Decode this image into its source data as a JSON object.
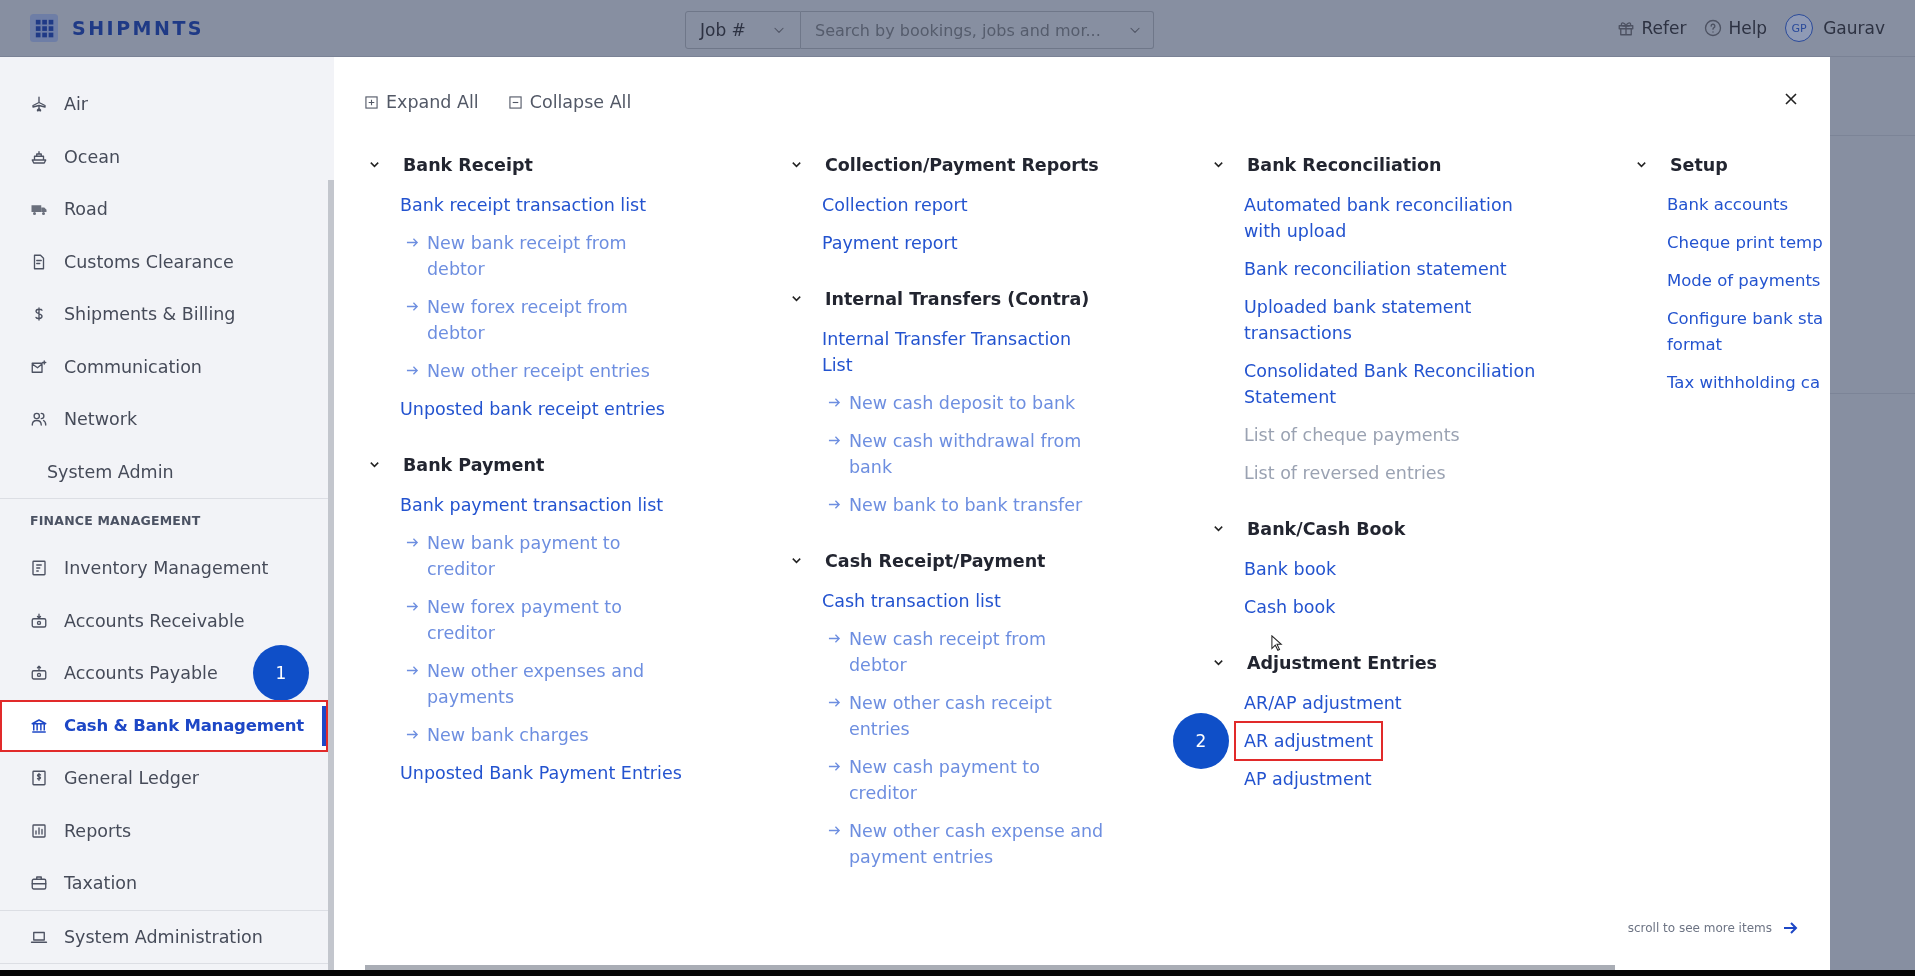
{
  "top_bar": {
    "logo": "SHIPMNTS",
    "search_type": "Job #",
    "search": {
      "placeholder": "Search by bookings, jobs and mor..."
    },
    "refer": "Refer",
    "help": "Help",
    "avatar": "GP",
    "user": "Gaurav"
  },
  "sidebar": {
    "groups": [
      {
        "items": [
          {
            "label": "Air",
            "selected": false,
            "highlighted": false
          },
          {
            "label": "Ocean",
            "selected": false,
            "highlighted": false
          },
          {
            "label": "Road",
            "selected": false,
            "highlighted": false
          },
          {
            "label": "Customs Clearance",
            "selected": false,
            "highlighted": false
          },
          {
            "label": "Shipments & Billing",
            "selected": false,
            "highlighted": false
          },
          {
            "label": "Communication",
            "selected": false,
            "highlighted": false
          },
          {
            "label": "Network",
            "selected": false,
            "highlighted": false
          },
          {
            "label": "System Admin",
            "selected": false,
            "highlighted": false,
            "kind": "plain"
          }
        ]
      },
      {
        "heading": "FINANCE MANAGEMENT",
        "items": [
          {
            "label": "Inventory Management",
            "selected": false,
            "highlighted": false
          },
          {
            "label": "Accounts Receivable",
            "selected": false,
            "highlighted": false
          },
          {
            "label": "Accounts Payable",
            "selected": false,
            "highlighted": false,
            "marker": "1"
          },
          {
            "label": "Cash & Bank Management",
            "selected": true,
            "highlighted": true
          },
          {
            "label": "General Ledger",
            "selected": false,
            "highlighted": false
          },
          {
            "label": "Reports",
            "selected": false,
            "highlighted": false
          },
          {
            "label": "Taxation",
            "selected": false,
            "highlighted": false
          }
        ]
      },
      {
        "items": [
          {
            "label": "System Administration",
            "selected": false,
            "highlighted": false
          }
        ]
      }
    ]
  },
  "panel": {
    "expand_all": "Expand All",
    "collapse_all": "Collapse All",
    "footer": "scroll to see more items",
    "columns": [
      {
        "sections": [
          {
            "title": "Bank Receipt",
            "expanded": true,
            "items": [
              {
                "text": "Bank receipt transaction list",
                "kind": "link"
              },
              {
                "text": "New bank receipt from debtor",
                "kind": "sub"
              },
              {
                "text": "New forex receipt from debtor",
                "kind": "sub"
              },
              {
                "text": "New other receipt entries",
                "kind": "sub"
              },
              {
                "text": "Unposted bank receipt entries",
                "kind": "link"
              }
            ]
          },
          {
            "title": "Bank Payment",
            "expanded": true,
            "items": [
              {
                "text": "Bank payment transaction list",
                "kind": "link"
              },
              {
                "text": "New bank payment to creditor",
                "kind": "sub"
              },
              {
                "text": "New forex payment to creditor",
                "kind": "sub"
              },
              {
                "text": "New other expenses and payments",
                "kind": "sub"
              },
              {
                "text": "New bank charges",
                "kind": "sub"
              },
              {
                "text": "Unposted Bank Payment Entries",
                "kind": "link"
              }
            ]
          }
        ]
      },
      {
        "sections": [
          {
            "title": "Collection/Payment Reports",
            "expanded": true,
            "items": [
              {
                "text": "Collection report",
                "kind": "link"
              },
              {
                "text": "Payment report",
                "kind": "link"
              }
            ]
          },
          {
            "title": "Internal Transfers (Contra)",
            "expanded": true,
            "items": [
              {
                "text": "Internal Transfer Transaction List",
                "kind": "link"
              },
              {
                "text": "New cash deposit to bank",
                "kind": "sub"
              },
              {
                "text": "New cash withdrawal from bank",
                "kind": "sub"
              },
              {
                "text": "New bank to bank transfer",
                "kind": "sub"
              }
            ]
          },
          {
            "title": "Cash Receipt/Payment",
            "expanded": true,
            "items": [
              {
                "text": "Cash transaction list",
                "kind": "link"
              },
              {
                "text": "New cash receipt from debtor",
                "kind": "sub"
              },
              {
                "text": "New other cash receipt entries",
                "kind": "sub"
              },
              {
                "text": "New cash payment to creditor",
                "kind": "sub"
              },
              {
                "text": "New other cash expense and payment entries",
                "kind": "sub"
              }
            ]
          }
        ]
      },
      {
        "sections": [
          {
            "title": "Bank Reconciliation",
            "expanded": true,
            "items": [
              {
                "text": "Automated bank reconciliation with upload",
                "kind": "link",
                "disabled": false
              },
              {
                "text": "Bank reconciliation statement",
                "kind": "link",
                "disabled": false
              },
              {
                "text": "Uploaded bank statement transactions",
                "kind": "link",
                "disabled": false
              },
              {
                "text": "Consolidated Bank Reconciliation Statement",
                "kind": "link",
                "disabled": false
              },
              {
                "text": "List of cheque payments",
                "kind": "link",
                "disabled": true
              },
              {
                "text": "List of reversed entries",
                "kind": "link",
                "disabled": true
              }
            ]
          },
          {
            "title": "Bank/Cash Book",
            "expanded": true,
            "items": [
              {
                "text": "Bank book",
                "kind": "link"
              },
              {
                "text": "Cash book",
                "kind": "link"
              }
            ]
          },
          {
            "title": "Adjustment Entries",
            "expanded": true,
            "items": [
              {
                "text": "AR/AP adjustment",
                "kind": "link",
                "highlighted": false
              },
              {
                "text": "AR adjustment",
                "kind": "link",
                "highlighted": true,
                "marker": "2"
              },
              {
                "text": "AP adjustment",
                "kind": "link",
                "highlighted": false
              }
            ]
          }
        ]
      },
      {
        "sections": [
          {
            "title": "Setup",
            "expanded": true,
            "items": [
              {
                "text": "Bank accounts",
                "kind": "link"
              },
              {
                "text": "Cheque print temp",
                "kind": "link"
              },
              {
                "text": "Mode of payments",
                "kind": "link"
              },
              {
                "text": "Configure bank sta format",
                "kind": "link"
              },
              {
                "text": "Tax withholding ca",
                "kind": "link"
              }
            ]
          }
        ]
      }
    ]
  }
}
